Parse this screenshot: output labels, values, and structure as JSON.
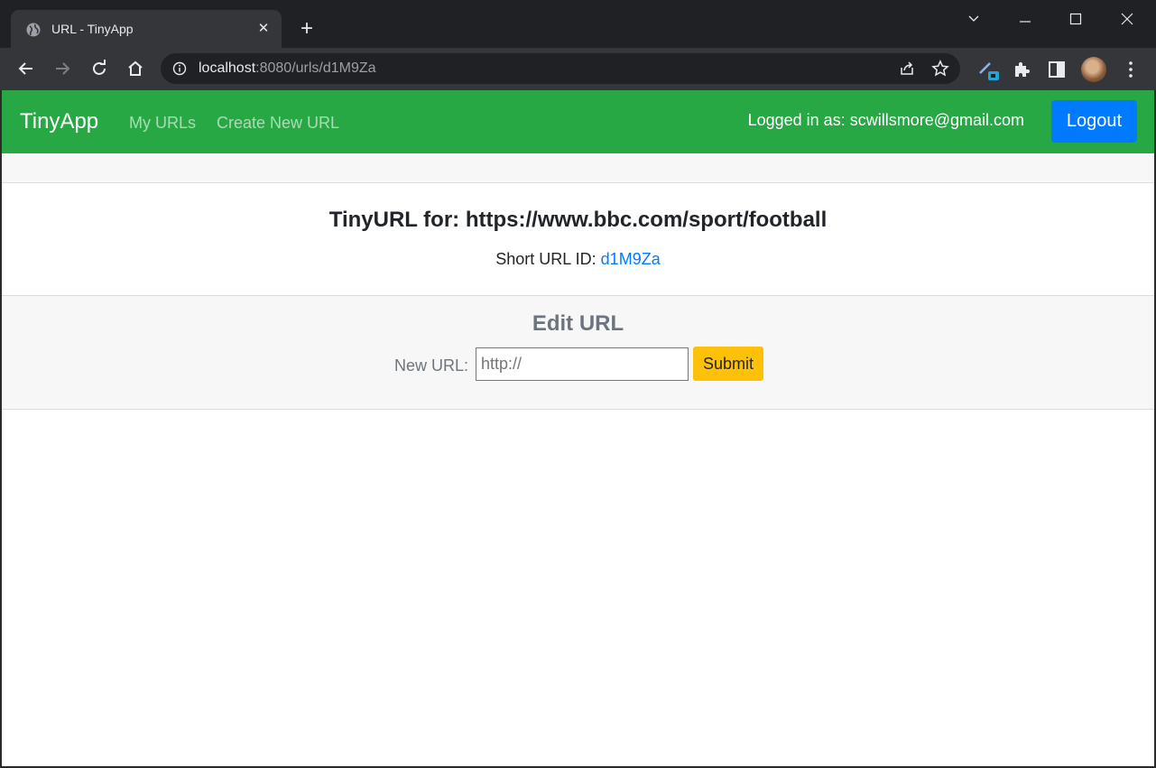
{
  "browser": {
    "tab_title": "URL - TinyApp",
    "url_host": "localhost",
    "url_path": ":8080/urls/d1M9Za"
  },
  "navbar": {
    "brand": "TinyApp",
    "links": [
      "My URLs",
      "Create New URL"
    ],
    "logged_in_text": "Logged in as: scwillsmore@gmail.com",
    "logout_label": "Logout",
    "color": "#28a745"
  },
  "details": {
    "title": "TinyURL for: https://www.bbc.com/sport/football",
    "short_label": "Short URL ID:",
    "short_id": "d1M9Za"
  },
  "edit": {
    "title": "Edit URL",
    "label": "New URL:",
    "placeholder": "http://",
    "submit_label": "Submit"
  }
}
